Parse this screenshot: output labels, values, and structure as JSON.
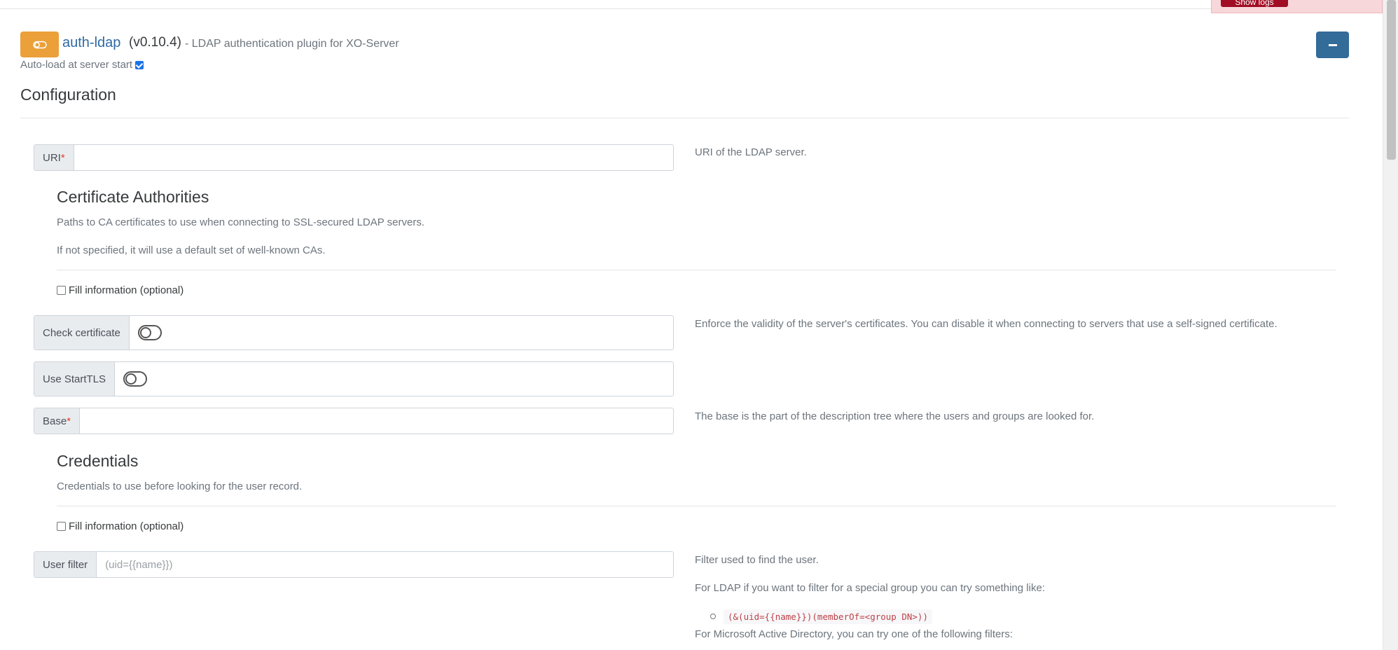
{
  "toast": {
    "button_label": "Show logs"
  },
  "plugin": {
    "name": "auth-ldap",
    "version": "(v0.10.4)",
    "description": "- LDAP authentication plugin for XO-Server",
    "autoload_label": "Auto-load at server start",
    "autoload_checked": true
  },
  "config": {
    "title": "Configuration",
    "uri": {
      "label": "URI",
      "required_mark": "*",
      "value": "",
      "help": "URI of the LDAP server."
    },
    "ca": {
      "title": "Certificate Authorities",
      "desc1": "Paths to CA certificates to use when connecting to SSL-secured LDAP servers.",
      "desc2": "If not specified, it will use a default set of well-known CAs.",
      "fill_label": "Fill information (optional)"
    },
    "check_cert": {
      "label": "Check certificate",
      "on": false,
      "help": "Enforce the validity of the server's certificates. You can disable it when connecting to servers that use a self-signed certificate."
    },
    "starttls": {
      "label": "Use StartTLS",
      "on": false
    },
    "base": {
      "label": "Base",
      "required_mark": "*",
      "value": "",
      "help": "The base is the part of the description tree where the users and groups are looked for."
    },
    "credentials": {
      "title": "Credentials",
      "desc": "Credentials to use before looking for the user record.",
      "fill_label": "Fill information (optional)"
    },
    "user_filter": {
      "label": "User filter",
      "placeholder": "(uid={{name}})",
      "help1": "Filter used to find the user.",
      "help2": "For LDAP if you want to filter for a special group you can try something like:",
      "code": "(&(uid={{name}})(memberOf=<group DN>))",
      "help3": "For Microsoft Active Directory, you can try one of the following filters:"
    }
  },
  "colors": {
    "accent": "#336b99",
    "plugin_icon": "#eba03a",
    "link": "#2f6aa3",
    "danger": "#a10d24"
  }
}
